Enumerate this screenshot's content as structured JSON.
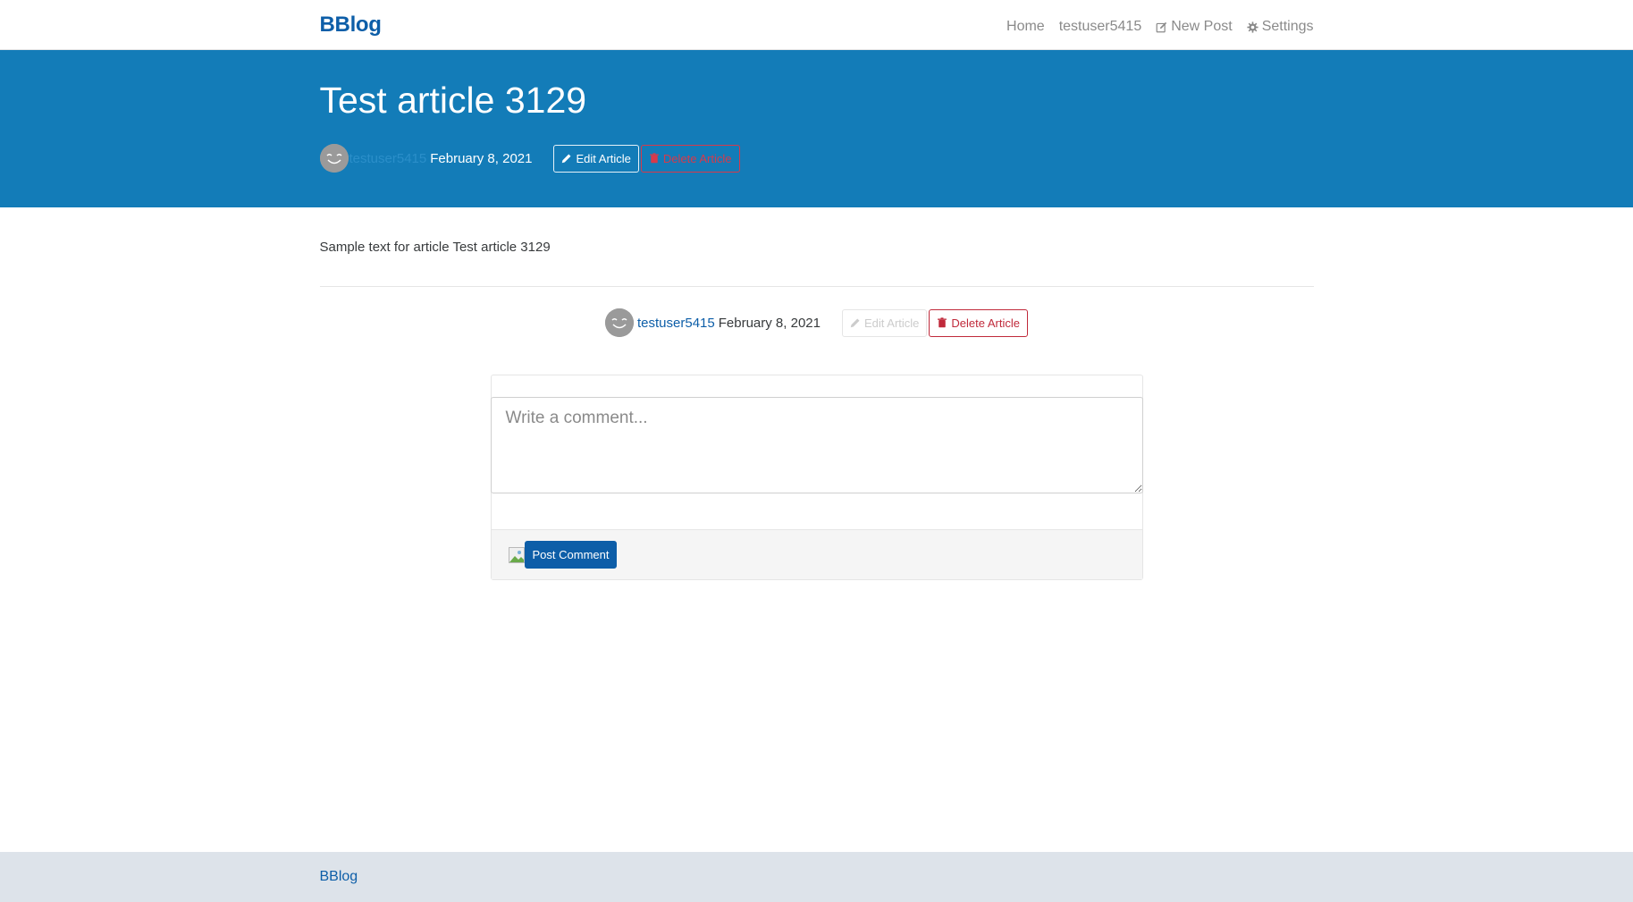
{
  "navbar": {
    "brand": "BBlog",
    "links": {
      "home": "Home",
      "profile": "testuser5415",
      "new_post": "New Post",
      "settings": "Settings"
    }
  },
  "article": {
    "title": "Test article 3129",
    "author": "testuser5415",
    "date": "February 8, 2021",
    "body": "Sample text for article Test article 3129"
  },
  "actions": {
    "edit_label": "Edit Article",
    "delete_label": "Delete Article"
  },
  "comment_form": {
    "placeholder": "Write a comment...",
    "submit_label": "Post Comment"
  },
  "footer": {
    "brand": "BBlog"
  },
  "icons": {
    "new_post": "edit-icon",
    "settings": "gear-icon",
    "edit": "pencil-icon",
    "delete": "trash-icon",
    "avatar": "smiley-avatar",
    "comment_author": "broken-image-icon"
  },
  "colors": {
    "brand": "#0d5ea8",
    "banner": "#137cb8",
    "danger": "#c02a3b",
    "footer": "#dde3ea"
  }
}
